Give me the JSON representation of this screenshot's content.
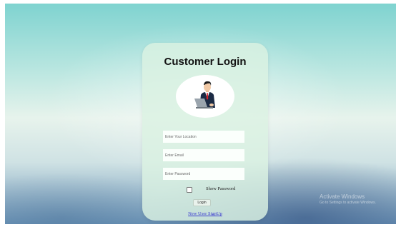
{
  "login_card": {
    "title": "Customer Login",
    "location_placeholder": "Enter Your Location",
    "email_placeholder": "Enter Email",
    "password_placeholder": "Enter Password",
    "show_password_label": "Show Password",
    "show_password_checked": false,
    "login_label": "Login",
    "signup_link": "New User SignUp"
  },
  "watermark": {
    "title": "Activate Windows",
    "subtitle": "Go to Settings to activate Windows."
  },
  "colors": {
    "card_background": "#daf2e2",
    "link": "#3b3bd0",
    "avatar_suit": "#1b2a44",
    "avatar_tie": "#d2232a"
  }
}
